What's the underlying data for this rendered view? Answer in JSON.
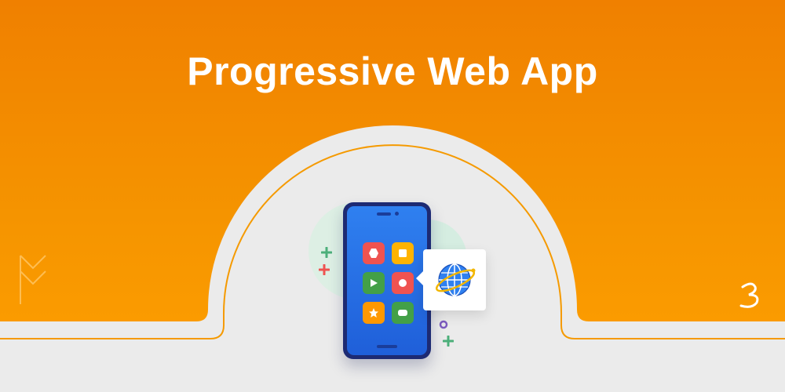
{
  "banner": {
    "title": "Progressive Web App"
  },
  "colors": {
    "background_top": "#f08000",
    "background_bottom": "#ffa000",
    "arch": "#ebebeb",
    "phone_frame": "#1d2a73",
    "phone_screen": "#2f80f0"
  },
  "phone": {
    "tiles": [
      {
        "icon": "hexagon-icon",
        "color": "#ef5350"
      },
      {
        "icon": "square-icon",
        "color": "#ffb300"
      },
      {
        "icon": "play-icon",
        "color": "#43a047"
      },
      {
        "icon": "circle-icon",
        "color": "#ef5350"
      },
      {
        "icon": "star-icon",
        "color": "#ff9800"
      },
      {
        "icon": "message-icon",
        "color": "#43a047"
      }
    ]
  },
  "decorations": [
    "plus-icon",
    "globe-icon",
    "orbit-icon"
  ]
}
